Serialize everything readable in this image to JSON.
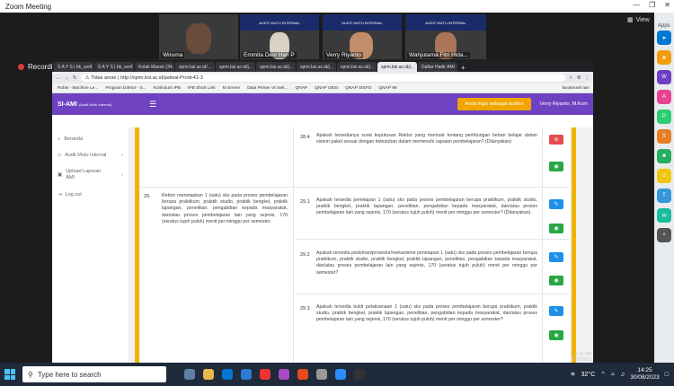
{
  "zoom": {
    "title": "Zoom Meeting",
    "view_label": "View",
    "recording_label": "Recording...",
    "participants": [
      "Wiruma",
      "Emmita Devi Hari P",
      "Verry Riyanto",
      "Wahjutama Fitri Hida..."
    ],
    "banner_text": "AUDIT MUTU INTERNAL"
  },
  "apps_panel": {
    "title": "Apps"
  },
  "browser": {
    "tabs": [
      "S A Y S | bk_verif",
      "S A Y S | bk_verif",
      "Kotak Masuk (34...",
      "spmi.bsi.ac.id/...",
      "spmi.bsi.ac.id/j...",
      "spmi.bsi.ac.id/j...",
      "spmi.bsi.ac.id/j...",
      "spmi.bsi.ac.id/j...",
      "spmi.bsi.ac.id/j...",
      "Daftar Hadir AMI"
    ],
    "security_label": "Tidak aman",
    "url": "http://spmi.bsi.ac.id/jadwal-Prodi-41-3",
    "bookmarks": [
      "Robis - Machine Le...",
      "Program Doktor - S...",
      "Kurikulum IPB",
      "IPB Short Link",
      "M Server",
      "Data Primer vs Sek...",
      "QNAP",
      "QNAP UBSI",
      "QNAP SISFO",
      "QNAP 98",
      "Bookmark lain"
    ]
  },
  "app": {
    "brand": "SI-AMI",
    "brand_sub": "(Audit Mutu Internal)",
    "login_button": "Anda login sebagai auditor",
    "user": "Verry Riyanto, M.Kom",
    "nav": [
      "Beranda",
      "Audit Mutu Internal",
      "Upload Laporan AMI",
      "Log out"
    ]
  },
  "items": {
    "row284": {
      "num": "28.4",
      "text": "Apakah tersedianya surat keputusan Rektor yang memuat tentang perhitungan beban belajar dalam sistem paket sesuai dengan kebutuhan dalam memenuhi capaian pembelajaran? (Dilanyakan)"
    },
    "row29": {
      "num": "29.",
      "text": "Rektor menetapkan 1 (satu) sks pada proses pembelajaran berupa praktikum, praktik studio, praktik bengkel, praktik lapangan, penelitian, pengabdian kepada masyarakat, dan/atau proses pembelajaran lain yang sejenis, 170 (seratus tujuh puluh) menit per minggu per semester.",
      "subs": [
        {
          "num": "29.1",
          "text": "Apakah tersedia penetapan 1 (satu) sks pada proses pembelajaran berupa praktikum, praktik studio, praktik bengkel, praktik lapangan, penelitian, pengabdian kepada masyarakat, dan/atau proses pembelajaran lain yang sejenis, 170 (seratus tujuh puluh) menit per minggu per semester? (Ditanyakan)"
        },
        {
          "num": "29.2",
          "text": "Apakah tersedia pedoman/prosedur/mekanisme penetapan 1 (satu) sks pada proses pembelajaran berupa praktikum, praktik studio, praktik bengkel, praktik lapangan, penelitian, pengabdian kepada masyarakat, dan/atau proses pembelajaran lain yang sejenis, 170 (seratus tujuh puluh) menit per minggu per semester?"
        },
        {
          "num": "29.3",
          "text": "Apakah tersedia bukti pelaksanaan 1 (satu) sks pada proses pembelajaran berupa praktikum, praktik studio, praktik bengkel, praktik lapangan, penelitian, pengabdian kepada masyarakat, dan/atau proses pembelajaran lain yang sejenis, 170 (seratus tujuh puluh) menit per minggu per semester?"
        }
      ]
    }
  },
  "screen_time": {
    "time": "2:25 PM",
    "date": "8/30/2023"
  },
  "taskbar": {
    "search_placeholder": "Type here to search",
    "temperature": "32°C",
    "time": "14:25",
    "date": "30/08/2023"
  },
  "colors": {
    "header": "#6f42c1",
    "accent": "#f0b400",
    "button_blue": "#1e90e8",
    "button_green": "#28a745",
    "button_red": "#e64c4c"
  }
}
